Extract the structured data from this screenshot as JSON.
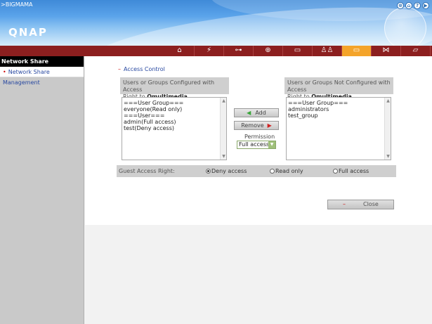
{
  "header": {
    "server_name": ">BIGMAMA",
    "logo": "QNAP",
    "top_icons": [
      "⊕",
      "⌂",
      "?",
      "▶"
    ]
  },
  "navbar": {
    "icons": [
      {
        "name": "home-nav-icon",
        "glyph": "⌂"
      },
      {
        "name": "quick-config-nav-icon",
        "glyph": "⚡"
      },
      {
        "name": "system-tools-nav-icon",
        "glyph": "⊶"
      },
      {
        "name": "network-nav-icon",
        "glyph": "⊕"
      },
      {
        "name": "disk-nav-icon",
        "glyph": "▭"
      },
      {
        "name": "users-nav-icon",
        "glyph": "♙♙"
      },
      {
        "name": "share-folder-nav-icon",
        "glyph": "▭",
        "active": true
      },
      {
        "name": "services-nav-icon",
        "glyph": "⋈"
      },
      {
        "name": "status-nav-icon",
        "glyph": "▱"
      }
    ]
  },
  "sidebar": {
    "title": "Network Share Management",
    "items": [
      "Network Share Management"
    ]
  },
  "content": {
    "section_title": "Access Control",
    "left_panel": {
      "heading_line1": "Users or Groups Configured with Access",
      "heading_line2_prefix": "Right to ",
      "share_name": "Qmultimedia",
      "items": [
        "===User Group===",
        "everyone(Read only)",
        "===User===",
        "admin(Full access)",
        "test(Deny access)"
      ]
    },
    "right_panel": {
      "heading_line1": "Users or Groups Not Configured with Access",
      "heading_line2_prefix": "Right to ",
      "share_name": "Qmultimedia",
      "items": [
        "===User Group===",
        "administrators",
        "test_group"
      ]
    },
    "add_label": "Add",
    "remove_label": "Remove",
    "permission_label": "Permission",
    "permission_value": "Full access",
    "guest": {
      "label": "Guest Access Right:",
      "options": [
        {
          "label": "Deny access",
          "selected": true
        },
        {
          "label": "Read only",
          "selected": false
        },
        {
          "label": "Full access",
          "selected": false
        }
      ]
    },
    "close_label": "Close"
  }
}
